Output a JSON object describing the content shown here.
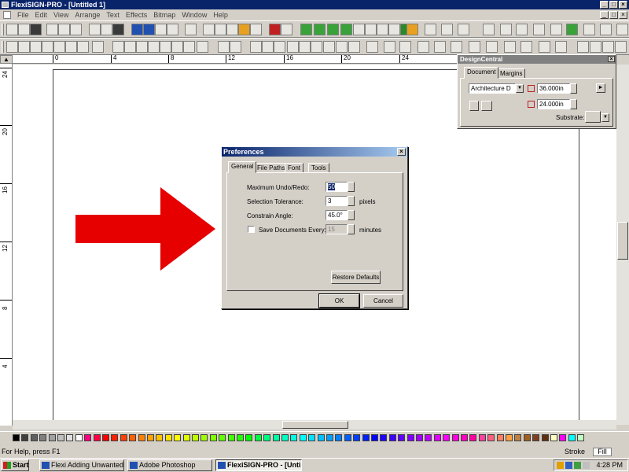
{
  "app": {
    "title": "FlexiSIGN-PRO - [Untitled 1]",
    "min": "_",
    "max": "□",
    "close": "×"
  },
  "menu": [
    "File",
    "Edit",
    "View",
    "Arrange",
    "Text",
    "Effects",
    "Bitmap",
    "Window",
    "Help"
  ],
  "ruler": {
    "corner": "▲",
    "h_ticks": [
      "0",
      "4",
      "8",
      "12",
      "16",
      "20",
      "24"
    ],
    "v_ticks": [
      "24",
      "20",
      "16",
      "12",
      "8",
      "4"
    ]
  },
  "design_central": {
    "title": "DesignCentral",
    "close": "×",
    "tabs": [
      "Document",
      "Margins"
    ],
    "paper_size": "Architecture D",
    "width": "36.000in",
    "height": "24.000in",
    "substrate_label": "Substrate:",
    "dropdown_arrow": "▼",
    "next_arrow": "►"
  },
  "dialog": {
    "title": "Preferences",
    "close": "×",
    "tabs": [
      "General",
      "File Paths",
      "Font",
      "Tools"
    ],
    "max_undo_label": "Maximum Undo/Redo:",
    "max_undo_value": "50",
    "selection_tolerance_label": "Selection Tolerance:",
    "selection_tolerance_value": "3",
    "selection_tolerance_unit": "pixels",
    "constrain_angle_label": "Constrain Angle:",
    "constrain_angle_value": "45.0°",
    "save_every_label": "Save Documents Every:",
    "save_every_value": "15",
    "save_every_unit": "minutes",
    "save_every_checked": false,
    "restore_defaults": "Restore Defaults",
    "ok": "OK",
    "cancel": "Cancel",
    "spin_up": "▲",
    "spin_down": "▼"
  },
  "palette_colors": [
    "#000000",
    "#404040",
    "#606060",
    "#808080",
    "#a0a0a0",
    "#c0c0c0",
    "#e0e0e0",
    "#ffffff",
    "#ff0080",
    "#ff0040",
    "#ff0000",
    "#ff2000",
    "#ff4000",
    "#ff6000",
    "#ff8000",
    "#ffa000",
    "#ffc000",
    "#ffe000",
    "#ffff00",
    "#e0ff00",
    "#c0ff00",
    "#a0ff00",
    "#80ff00",
    "#60ff00",
    "#40ff00",
    "#20ff00",
    "#00ff00",
    "#00ff40",
    "#00ff80",
    "#00ffa0",
    "#00ffc0",
    "#00ffe0",
    "#00ffff",
    "#00e0ff",
    "#00c0ff",
    "#00a0ff",
    "#0080ff",
    "#0060ff",
    "#0040ff",
    "#0020ff",
    "#0000ff",
    "#2000ff",
    "#4000ff",
    "#6000ff",
    "#8000ff",
    "#a000ff",
    "#c000ff",
    "#e000ff",
    "#ff00ff",
    "#ff00e0",
    "#ff00c0",
    "#ff00a0",
    "#ff40a0",
    "#ff6080",
    "#ff8060",
    "#ffa040",
    "#c08040",
    "#a06020",
    "#804020",
    "#603010",
    "#ffffc0",
    "#ff00ff",
    "#00ffff",
    "#c0ffc0"
  ],
  "status": {
    "help_text": "For Help, press F1",
    "stroke_label": "Stroke",
    "fill_label": "Fill"
  },
  "taskbar": {
    "start": "Start",
    "tasks": [
      "Flexi Adding Unwanted F...",
      "Adobe Photoshop",
      "FlexiSIGN-PRO - [Unti..."
    ],
    "clock": "4:28 PM"
  },
  "colors": {
    "arrow": "#e60000",
    "title_active": "#0a246a"
  }
}
